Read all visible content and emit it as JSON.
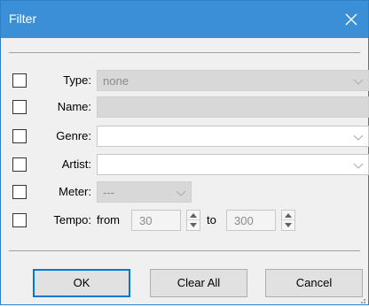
{
  "window": {
    "title": "Filter"
  },
  "rows": {
    "type": {
      "label": "Type:",
      "value": "none"
    },
    "name": {
      "label": "Name:",
      "value": ""
    },
    "genre": {
      "label": "Genre:",
      "value": ""
    },
    "artist": {
      "label": "Artist:",
      "value": ""
    },
    "meter": {
      "label": "Meter:",
      "value": "---"
    },
    "tempo": {
      "label": "Tempo:",
      "from_label": "from",
      "from_value": "30",
      "to_label": "to",
      "to_value": "300"
    }
  },
  "buttons": {
    "ok": "OK",
    "clear_all": "Clear All",
    "cancel": "Cancel"
  },
  "colors": {
    "titlebar": "#3b8fd6",
    "accent": "#0078d7"
  }
}
